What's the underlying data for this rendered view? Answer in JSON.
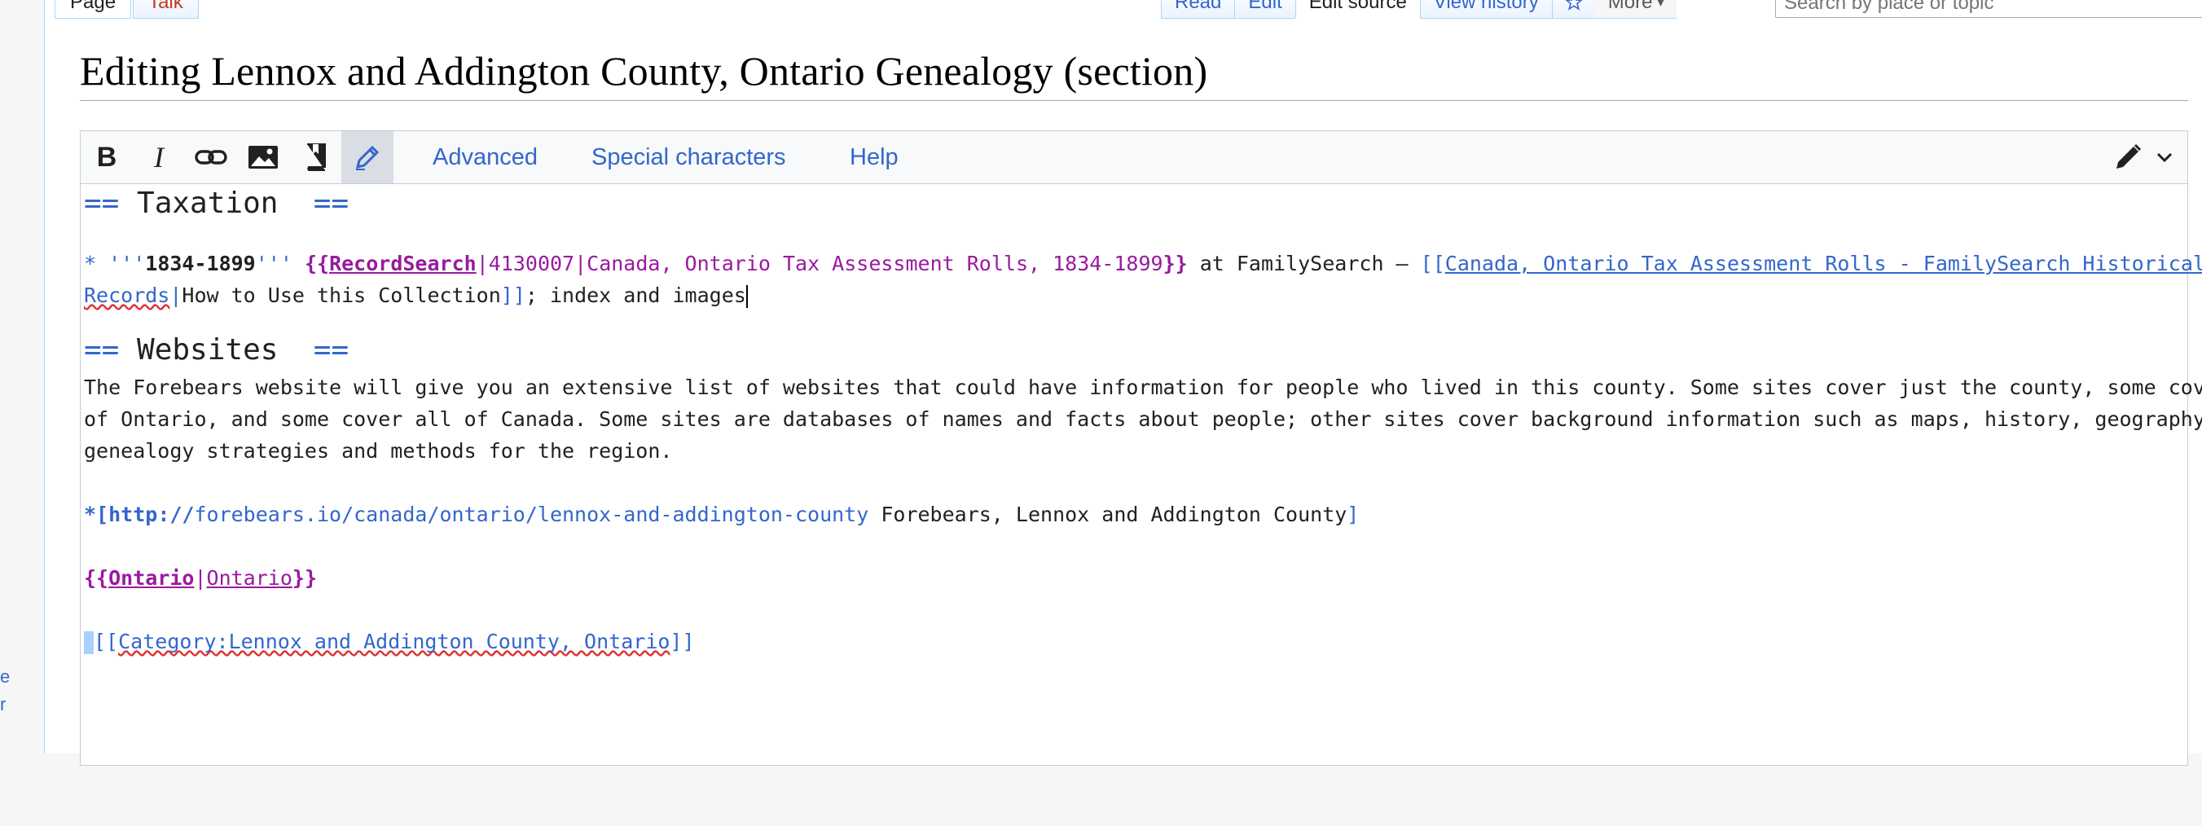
{
  "sidebar": {
    "snippets": [
      "e",
      "r"
    ]
  },
  "tabs_left": [
    {
      "label": "Page",
      "selected": true
    },
    {
      "label": "Talk",
      "selected": false
    }
  ],
  "tabs_right": [
    {
      "label": "Read"
    },
    {
      "label": "Edit"
    },
    {
      "label": "Edit source"
    },
    {
      "label": "View history"
    }
  ],
  "more_label": "More",
  "more_caret": "▾",
  "search": {
    "placeholder": "Search by place or topic"
  },
  "page_title": "Editing Lennox and Addington County, Ontario Genealogy (section)",
  "toolbar": {
    "bold_label": "B",
    "italic_label": "I",
    "advanced": "Advanced",
    "special_characters": "Special characters",
    "help": "Help"
  },
  "wikitext": {
    "h1_open": "==",
    "h1_text": " Taxation  ",
    "h1_close": "==",
    "bullet1_star": "* ",
    "bullet1_bold_open": "'''",
    "bullet1_years": "1834-1899",
    "bullet1_bold_close": "'''",
    "tpl1_open": "{{",
    "tpl1_name": "RecordSearch",
    "tpl1_params": "|4130007|Canada, Ontario Tax Assessment Rolls, 1834-1899",
    "tpl1_close": "}}",
    "bullet1_mid": " at FamilySearch – ",
    "link1_open": "[[",
    "link1_target_line1": "Canada, Ontario Tax Assessment Rolls - FamilySearch Historical ",
    "link1_target_line2": "Records",
    "link1_pipe": "|",
    "link1_text": "How to Use this Collection",
    "link1_close": "]]",
    "bullet1_end": "; index and images",
    "h2_open": "==",
    "h2_text": " Websites  ",
    "h2_close": "==",
    "para_line1": "The Forebears website will give you an extensive list of websites that could have information for people who lived in this county. Some sites cover just the county, some cover all",
    "para_line2": "of Ontario, and some cover all of Canada. Some sites are databases of names and facts about people; other sites cover background information such as maps, history, geography, or",
    "para_line3": "genealogy strategies and methods for the region.",
    "ext_star": "*[",
    "ext_proto": "http://",
    "ext_url": "forebears.io/canada/ontario/lennox-and-addington-county",
    "ext_label": " Forebears, Lennox and Addington County",
    "ext_close": "]",
    "tpl2_open": "{{",
    "tpl2_name": "Ontario",
    "tpl2_pipe": "|",
    "tpl2_param": "Ontario",
    "tpl2_close": "}}",
    "cat_open": "[[",
    "cat_target": "Category:Lennox and Addington County, Ontario",
    "cat_close": "]]"
  },
  "colors": {
    "link": "#3366cc",
    "template": "#9a1aa0",
    "tab_border": "#a7d7f9",
    "toolbar_bg": "#f8f9fa"
  },
  "icons": [
    "bold-icon",
    "italic-icon",
    "link-icon",
    "image-icon",
    "book-icon",
    "pencil-highlight-icon",
    "edit-mode-pencil-icon",
    "chevron-down-icon",
    "star-icon"
  ]
}
